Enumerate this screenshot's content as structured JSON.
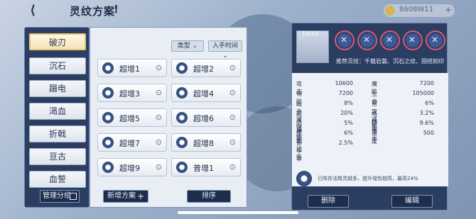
{
  "header": {
    "title": "灵纹方案",
    "info_symbol": "!",
    "back_symbol": "⟨",
    "currency_amount": "8608W11",
    "currency_plus": "+"
  },
  "categories": [
    {
      "label": "破刃",
      "active": true
    },
    {
      "label": "沉石",
      "active": false
    },
    {
      "label": "蹑电",
      "active": false
    },
    {
      "label": "渴血",
      "active": false
    },
    {
      "label": "折戟",
      "active": false
    },
    {
      "label": "亘古",
      "active": false
    },
    {
      "label": "血誓",
      "active": false
    }
  ],
  "manage_label": "管理分组",
  "sort": {
    "type_label": "类型",
    "time_label": "入手时间"
  },
  "schemes": [
    {
      "name": "超增1"
    },
    {
      "name": "超增2"
    },
    {
      "name": "超增3"
    },
    {
      "name": "超增4"
    },
    {
      "name": "超增5"
    },
    {
      "name": "超增6"
    },
    {
      "name": "超增7"
    },
    {
      "name": "超增8"
    },
    {
      "name": "超增9"
    },
    {
      "name": "普增1"
    }
  ],
  "new_scheme_label": "新增方案",
  "new_scheme_plus": "+",
  "sort_button_label": "排序",
  "detail": {
    "portrait_name": "10/10",
    "recommend": "推荐灵纹：千载岩磐、沉石之纹、固结刻印",
    "stats": [
      {
        "k": "攻击",
        "v": "10600"
      },
      {
        "k": "魔防",
        "v": "7200"
      },
      {
        "k": "物防",
        "v": "7200"
      },
      {
        "k": "生命",
        "v": "105000"
      },
      {
        "k": "超杀增伤",
        "v": "8%"
      },
      {
        "k": "普攻减伤",
        "v": "6%"
      },
      {
        "k": "超杀减伤",
        "v": "20%"
      },
      {
        "k": "格挡率",
        "v": "3.2%"
      },
      {
        "k": "闪避率",
        "v": "5%"
      },
      {
        "k": "破击率",
        "v": "9.6%"
      },
      {
        "k": "压制增伤",
        "v": "6%"
      },
      {
        "k": "速度",
        "v": "500"
      },
      {
        "k": "命中率",
        "v": "2.5%"
      }
    ],
    "bonus_text": "已阵存法精灵越多，提升增伤越高，最高24%",
    "delete_label": "删除",
    "edit_label": "编辑"
  },
  "colors": {
    "panel_dark": "#2b3e62",
    "accent_gold": "#e8c777",
    "slot_ring": "#d95a6e"
  }
}
